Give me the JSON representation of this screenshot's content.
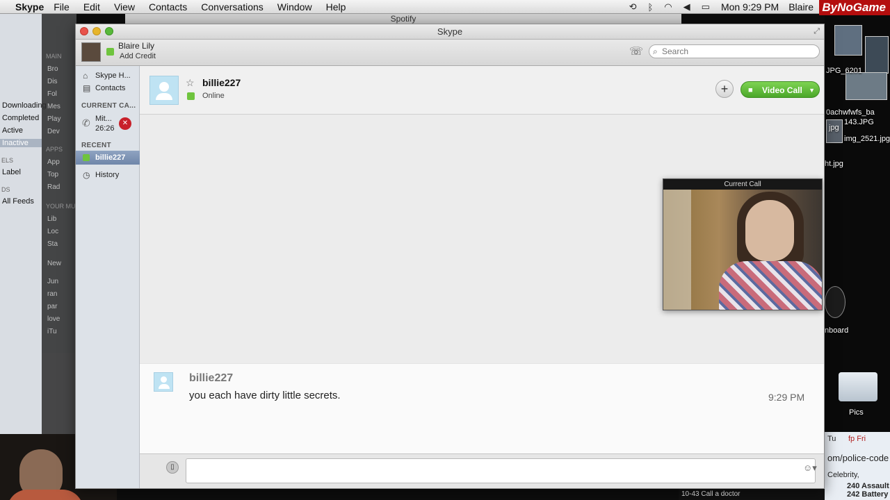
{
  "menubar": {
    "app": "Skype",
    "items": [
      "File",
      "Edit",
      "View",
      "Contacts",
      "Conversations",
      "Window",
      "Help"
    ],
    "clock": "Mon 9:29 PM",
    "user": "Blaire"
  },
  "watermark": "ByNoGame",
  "spotify": {
    "title": "Spotify",
    "left_items": [
      "Downloading",
      "Completed",
      "Active",
      "Inactive",
      "Label",
      "All Feeds"
    ],
    "left_sections": [
      "ELS",
      "DS"
    ],
    "side_headers": [
      "MAIN",
      "APPS",
      "YOUR MU"
    ],
    "side_items": [
      "Bro",
      "Dis",
      "Fol",
      "Mes",
      "Play",
      "Dev",
      "App",
      "Top",
      "Rad",
      "Lib",
      "Loc",
      "Sta",
      "New",
      "Jun",
      "ran",
      "par",
      "love",
      "iTu"
    ]
  },
  "skype": {
    "window_title": "Skype",
    "account": {
      "name": "Blaire Lily",
      "credit": "Add Credit"
    },
    "search_placeholder": "Search",
    "sidebar": {
      "home": "Skype H...",
      "contacts": "Contacts",
      "current_calls_header": "CURRENT CA...",
      "current_call": {
        "name": "Mit...",
        "duration": "26:26"
      },
      "recent_header": "RECENT",
      "recent_item": "billie227",
      "history": "History"
    },
    "conversation": {
      "contact": "billie227",
      "status": "Online",
      "video_call": "Video Call",
      "preview_label": "Current Call"
    },
    "message": {
      "sender": "billie227",
      "text": "you each have dirty little secrets.",
      "time": "9:29 PM"
    }
  },
  "desktop": {
    "labels": [
      "JPG_6201",
      "0achwfwfs_ba",
      "143.JPG",
      "jpg",
      "img_2521.jpg",
      "ht.jpg",
      "nboard",
      "Pics"
    ],
    "bottom_lines": [
      "Tu",
      "fp Fri",
      "om/police-code",
      "Celebrity,",
      "240 Assault",
      "242 Battery"
    ],
    "bar_text": "10-43 Call a doctor"
  },
  "colors": {
    "online": "#6fc43e",
    "video_button": "#4ba72a",
    "hangup": "#c8202a",
    "selected_row": "#7b90b1"
  }
}
